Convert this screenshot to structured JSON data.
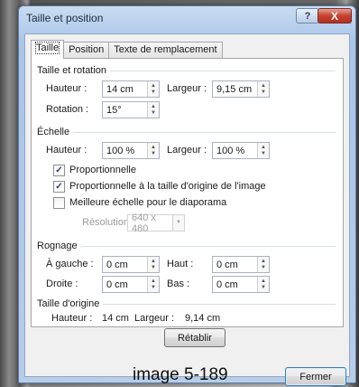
{
  "window": {
    "title": "Taille et position",
    "help_label": "?",
    "close_label": "X"
  },
  "tabs": [
    {
      "label": "Taille",
      "active": true
    },
    {
      "label": "Position",
      "active": false
    },
    {
      "label": "Texte de remplacement",
      "active": false
    }
  ],
  "size_rotation": {
    "heading": "Taille et rotation",
    "height_label": "Hauteur :",
    "height_value": "14 cm",
    "width_label": "Largeur :",
    "width_value": "9,15 cm",
    "rotation_label": "Rotation :",
    "rotation_value": "15°"
  },
  "scale": {
    "heading": "Échelle",
    "height_label": "Hauteur :",
    "height_value": "100 %",
    "width_label": "Largeur :",
    "width_value": "100 %",
    "proportional_label": "Proportionnelle",
    "proportional_checked": true,
    "relative_label": "Proportionnelle à la taille d'origine de l'image",
    "relative_checked": true,
    "best_scale_label": "Meilleure échelle pour le diaporama",
    "best_scale_checked": false,
    "resolution_label": "Résolution",
    "resolution_value": "640 x 480"
  },
  "crop": {
    "heading": "Rognage",
    "left_label": "À gauche :",
    "left_value": "0 cm",
    "top_label": "Haut :",
    "top_value": "0 cm",
    "right_label": "Droite :",
    "right_value": "0 cm",
    "bottom_label": "Bas :",
    "bottom_value": "0 cm"
  },
  "original": {
    "heading": "Taille d'origine",
    "height_label": "Hauteur :",
    "height_value": "14 cm",
    "width_label": "Largeur :",
    "width_value": "9,14 cm",
    "reset_label": "Rétablir"
  },
  "footer": {
    "caption": "image 5-189",
    "close_button_label": "Fermer"
  },
  "colors": {
    "title_bar": "#a9c5e8",
    "close_button": "#c6412f",
    "panel": "#ffffff"
  }
}
